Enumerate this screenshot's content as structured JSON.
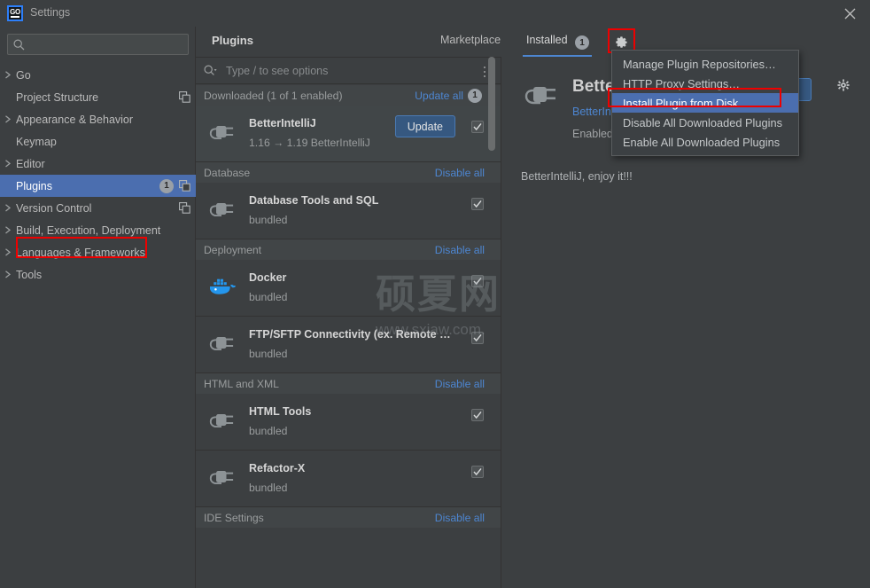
{
  "window": {
    "title": "Settings",
    "app_icon": "goland-go-icon",
    "close_label": "×"
  },
  "sidebar": {
    "search": {
      "value": "",
      "placeholder": ""
    },
    "items": [
      {
        "label": "Go",
        "arrow": true,
        "selected": false,
        "badge": null,
        "copy_icon": false
      },
      {
        "label": "Project Structure",
        "arrow": false,
        "selected": false,
        "badge": null,
        "copy_icon": true
      },
      {
        "label": "Appearance & Behavior",
        "arrow": true,
        "selected": false,
        "badge": null,
        "copy_icon": false
      },
      {
        "label": "Keymap",
        "arrow": false,
        "selected": false,
        "badge": null,
        "copy_icon": false
      },
      {
        "label": "Editor",
        "arrow": true,
        "selected": false,
        "badge": null,
        "copy_icon": false
      },
      {
        "label": "Plugins",
        "arrow": false,
        "selected": true,
        "badge": "1",
        "copy_icon": true
      },
      {
        "label": "Version Control",
        "arrow": true,
        "selected": false,
        "badge": null,
        "copy_icon": true
      },
      {
        "label": "Build, Execution, Deployment",
        "arrow": true,
        "selected": false,
        "badge": null,
        "copy_icon": false
      },
      {
        "label": "Languages & Frameworks",
        "arrow": true,
        "selected": false,
        "badge": null,
        "copy_icon": false
      },
      {
        "label": "Tools",
        "arrow": true,
        "selected": false,
        "badge": null,
        "copy_icon": false
      }
    ]
  },
  "plugins_panel": {
    "title": "Plugins",
    "filter": {
      "value": "",
      "placeholder": "Type / to see options"
    },
    "kebab_label": "more-options",
    "groups": [
      {
        "header": "Downloaded (1 of 1 enabled)",
        "action": "Update all",
        "action_badge": "1",
        "rows": [
          {
            "name": "BetterIntelliJ",
            "sub": "1.16 → 1.19  BetterIntelliJ",
            "icon": "plugin-plug-icon",
            "button": "Update",
            "checked": true,
            "highlighted": true
          }
        ]
      },
      {
        "header": "Database",
        "action": "Disable all",
        "action_badge": null,
        "rows": [
          {
            "name": "Database Tools and SQL",
            "sub": "bundled",
            "icon": "plugin-plug-icon",
            "button": null,
            "checked": true,
            "highlighted": false
          }
        ]
      },
      {
        "header": "Deployment",
        "action": "Disable all",
        "action_badge": null,
        "rows": [
          {
            "name": "Docker",
            "sub": "bundled",
            "icon": "docker-whale-icon",
            "button": null,
            "checked": true,
            "highlighted": false
          },
          {
            "name": "FTP/SFTP Connectivity (ex. Remote …",
            "sub": "bundled",
            "icon": "plugin-plug-icon",
            "button": null,
            "checked": true,
            "highlighted": false
          }
        ]
      },
      {
        "header": "HTML and XML",
        "action": "Disable all",
        "action_badge": null,
        "rows": [
          {
            "name": "HTML Tools",
            "sub": "bundled",
            "icon": "plugin-plug-icon",
            "button": null,
            "checked": true,
            "highlighted": false
          },
          {
            "name": "Refactor-X",
            "sub": "bundled",
            "icon": "plugin-plug-icon",
            "button": null,
            "checked": true,
            "highlighted": false
          }
        ]
      },
      {
        "header": "IDE Settings",
        "action": "Disable all",
        "action_badge": null,
        "rows": []
      }
    ]
  },
  "tabs": {
    "marketplace": "Marketplace",
    "installed": "Installed",
    "installed_badge": "1",
    "gear_label": "plugin-settings-gear"
  },
  "detail": {
    "title": "BetterIntelliJ",
    "vendor": "BetterIntelliJ",
    "status": "Enabled",
    "description": "BetterIntelliJ, enjoy it!!!",
    "gear_label": "detail-settings-gear"
  },
  "menu": {
    "items": [
      {
        "label": "Manage Plugin Repositories…",
        "selected": false
      },
      {
        "label": "HTTP Proxy Settings…",
        "selected": false
      },
      {
        "label": "Install Plugin from Disk…",
        "selected": true
      },
      {
        "label": "Disable All Downloaded Plugins",
        "selected": false
      },
      {
        "label": "Enable All Downloaded Plugins",
        "selected": false
      }
    ]
  },
  "watermark": {
    "cn": "硕夏网",
    "url": "www.sxiaw.com."
  },
  "colors": {
    "bg": "#3c3f41",
    "selection": "#4b6eaf",
    "link": "#4d86d1",
    "highlight_red": "#ee0000",
    "button_blue": "#365880",
    "docker_blue": "#2496ed"
  }
}
